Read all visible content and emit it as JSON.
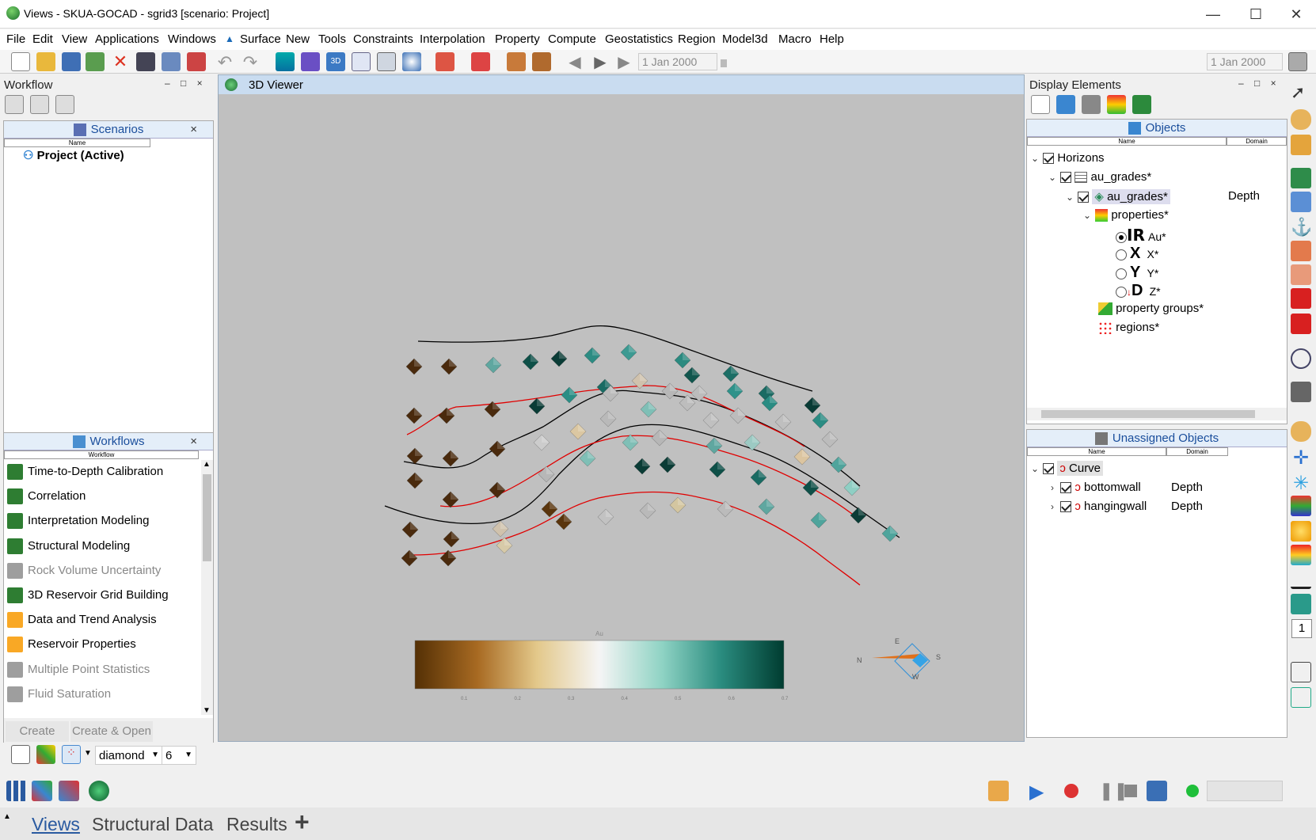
{
  "window": {
    "title": "Views - SKUA-GOCAD - sgrid3  [scenario: Project]",
    "minimize": "—",
    "maximize": "☐",
    "close": "✕"
  },
  "menu": [
    "File",
    "Edit",
    "View",
    "Applications",
    "Windows",
    "Surface",
    "New",
    "Tools",
    "Constraints",
    "Interpolation",
    "Property",
    "Compute",
    "Geostatistics",
    "Region",
    "Model3d",
    "Macro",
    "Help"
  ],
  "toolbar": {
    "date_left": "1 Jan 2000",
    "date_right": "1 Jan 2000"
  },
  "workflow_panel": {
    "title": "Workflow",
    "scenarios_tab": "Scenarios",
    "scenarios_col": "Name",
    "project_item": "Project (Active)",
    "workflows_tab": "Workflows",
    "workflows_col": "Workflow",
    "items": [
      {
        "label": "Time-to-Depth Calibration",
        "enabled": true,
        "color": "#2e7d32"
      },
      {
        "label": "Correlation",
        "enabled": true,
        "color": "#2e7d32"
      },
      {
        "label": "Interpretation Modeling",
        "enabled": true,
        "color": "#2e7d32"
      },
      {
        "label": "Structural Modeling",
        "enabled": true,
        "color": "#2e7d32"
      },
      {
        "label": "Rock Volume Uncertainty",
        "enabled": false,
        "color": "#9e9e9e"
      },
      {
        "label": "3D Reservoir Grid Building",
        "enabled": true,
        "color": "#2e7d32"
      },
      {
        "label": "Data and Trend Analysis",
        "enabled": true,
        "color": "#f9a825"
      },
      {
        "label": "Reservoir Properties",
        "enabled": true,
        "color": "#f9a825"
      },
      {
        "label": "Multiple Point Statistics",
        "enabled": false,
        "color": "#9e9e9e"
      },
      {
        "label": "Fluid Saturation",
        "enabled": false,
        "color": "#9e9e9e"
      }
    ],
    "create_btn": "Create",
    "create_open_btn": "Create & Open"
  },
  "viewer": {
    "title": "3D Viewer",
    "colorbar_label": "Au",
    "colorbar_ticks": [
      "0.1",
      "0.2",
      "0.3",
      "0.4",
      "0.5",
      "0.6",
      "0.7"
    ],
    "compass": {
      "n": "N",
      "e": "E",
      "s": "S",
      "w": "W"
    }
  },
  "display_elements": {
    "title": "Display Elements",
    "objects_tab": "Objects",
    "col_name": "Name",
    "col_domain": "Domain",
    "tree": {
      "horizons": "Horizons",
      "au_grades_1": "au_grades*",
      "au_grades_2": "au_grades*",
      "au_grades_domain": "Depth",
      "properties": "properties*",
      "prop_au": "Au*",
      "prop_x": "X*",
      "prop_y": "Y*",
      "prop_z": "Z*",
      "glyph_au": "IR",
      "glyph_x": "X",
      "glyph_y": "Y",
      "glyph_z": "D",
      "property_groups": "property groups*",
      "regions": "regions*"
    },
    "unassigned_tab": "Unassigned Objects",
    "unassigned": {
      "curve": "Curve",
      "bottomwall": "bottomwall",
      "bottomwall_domain": "Depth",
      "hangingwall": "hangingwall",
      "hangingwall_domain": "Depth"
    }
  },
  "bottom_toolbar": {
    "symbol": "diamond",
    "size": "6"
  },
  "side_counter": "1",
  "bottom_tabs": [
    "Views",
    "Structural Data",
    "Results",
    "+"
  ]
}
